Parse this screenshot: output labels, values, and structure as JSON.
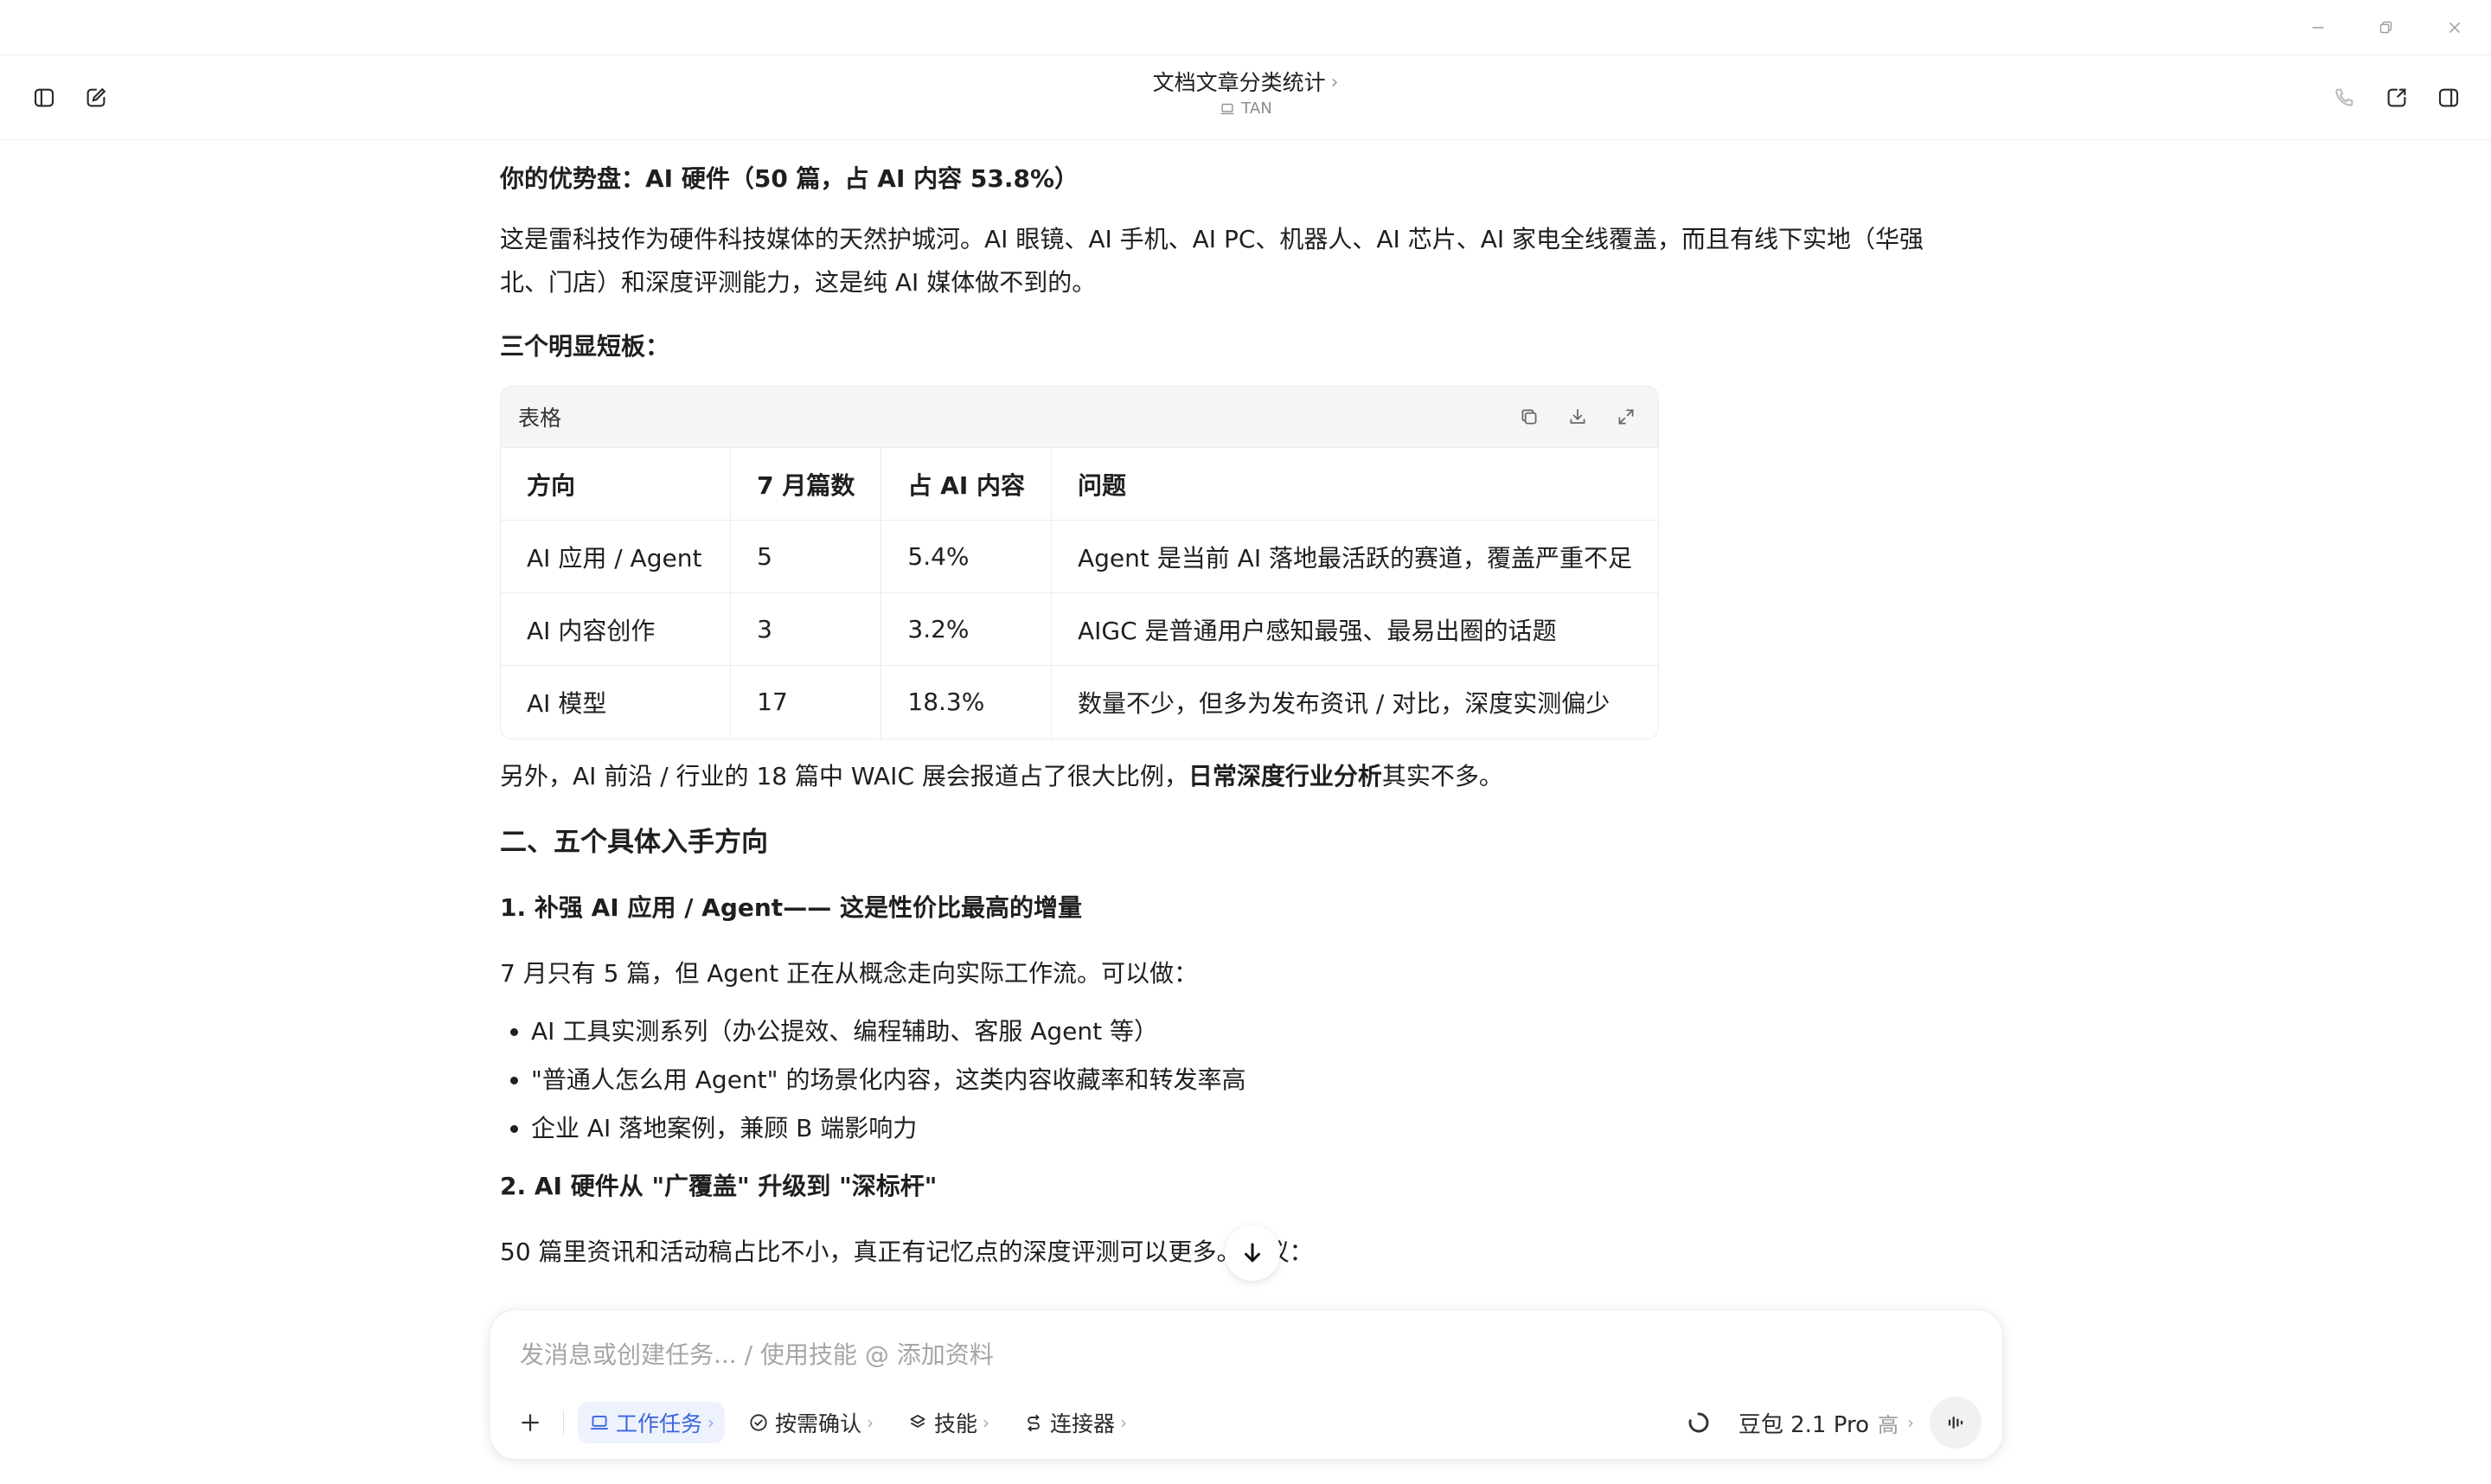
{
  "header": {
    "title": "文档文章分类统计",
    "subtitle": "TAN"
  },
  "content": {
    "strength_heading": "你的优势盘：AI 硬件（50 篇，占 AI 内容 53.8%）",
    "strength_text": "这是雷科技作为硬件科技媒体的天然护城河。AI 眼镜、AI 手机、AI PC、机器人、AI 芯片、AI 家电全线覆盖，而且有线下实地（华强北、门店）和深度评测能力，这是纯 AI 媒体做不到的。",
    "weakness_heading": "三个明显短板：",
    "table": {
      "label": "表格",
      "headers": [
        "方向",
        "7 月篇数",
        "占 AI 内容",
        "问题"
      ],
      "rows": [
        [
          "AI 应用 / Agent",
          "5",
          "5.4%",
          "Agent 是当前 AI 落地最活跃的赛道，覆盖严重不足"
        ],
        [
          "AI 内容创作",
          "3",
          "3.2%",
          "AIGC 是普通用户感知最强、最易出圈的话题"
        ],
        [
          "AI 模型",
          "17",
          "18.3%",
          "数量不少，但多为发布资讯 / 对比，深度实测偏少"
        ]
      ]
    },
    "note_pre": "另外，AI 前沿 / 行业的 18 篇中 WAIC 展会报道占了很大比例，",
    "note_bold": "日常深度行业分析",
    "note_post": "其实不多。",
    "section2_heading": "二、五个具体入手方向",
    "item1_heading": "1. 补强 AI 应用 / Agent—— 这是性价比最高的增量",
    "item1_text": "7 月只有 5 篇，但 Agent 正在从概念走向实际工作流。可以做：",
    "item1_bullets": [
      "AI 工具实测系列（办公提效、编程辅助、客服 Agent 等）",
      "\"普通人怎么用 Agent\" 的场景化内容，这类内容收藏率和转发率高",
      "企业 AI 落地案例，兼顾 B 端影响力"
    ],
    "item2_heading": "2. AI 硬件从 \"广覆盖\" 升级到 \"深标杆\"",
    "item2_text": "50 篇里资讯和活动稿占比不小，真正有记忆点的深度评测可以更多。建议："
  },
  "composer": {
    "placeholder": "发消息或创建任务... / 使用技能 @ 添加资料",
    "chips": {
      "task": "工作任务",
      "confirm": "按需确认",
      "skills": "技能",
      "connector": "连接器"
    },
    "model_name": "豆包 2.1 Pro",
    "model_level": "高"
  },
  "colors": {
    "accent": "#3b64e0",
    "active_chip_bg": "#eef2fd"
  }
}
